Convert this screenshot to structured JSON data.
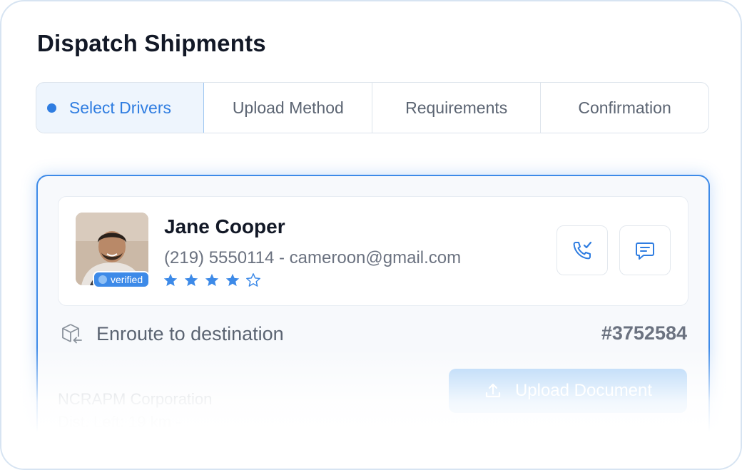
{
  "page": {
    "title": "Dispatch Shipments"
  },
  "steps": [
    {
      "label": "Select Drivers"
    },
    {
      "label": "Upload Method"
    },
    {
      "label": "Requirements"
    },
    {
      "label": "Confirmation"
    }
  ],
  "driver": {
    "name": "Jane Cooper",
    "contact": "(219) 5550114 - cameroon@gmail.com",
    "badge": "verified",
    "rating": {
      "value": 4,
      "max": 5
    }
  },
  "shipment": {
    "status": "Enroute to destination",
    "id": "#3752584",
    "company": "NCRAPM Corporation",
    "distance": "Dist. Left: 19 km -",
    "upload_label": "Upload Document"
  },
  "colors": {
    "accent": "#2f7de1",
    "card_border": "#3d8ae8",
    "upload_button": "#a9d0f7"
  },
  "icons": {
    "call": "phone-check-icon",
    "message": "message-icon",
    "status": "package-return-icon",
    "upload": "upload-icon"
  }
}
